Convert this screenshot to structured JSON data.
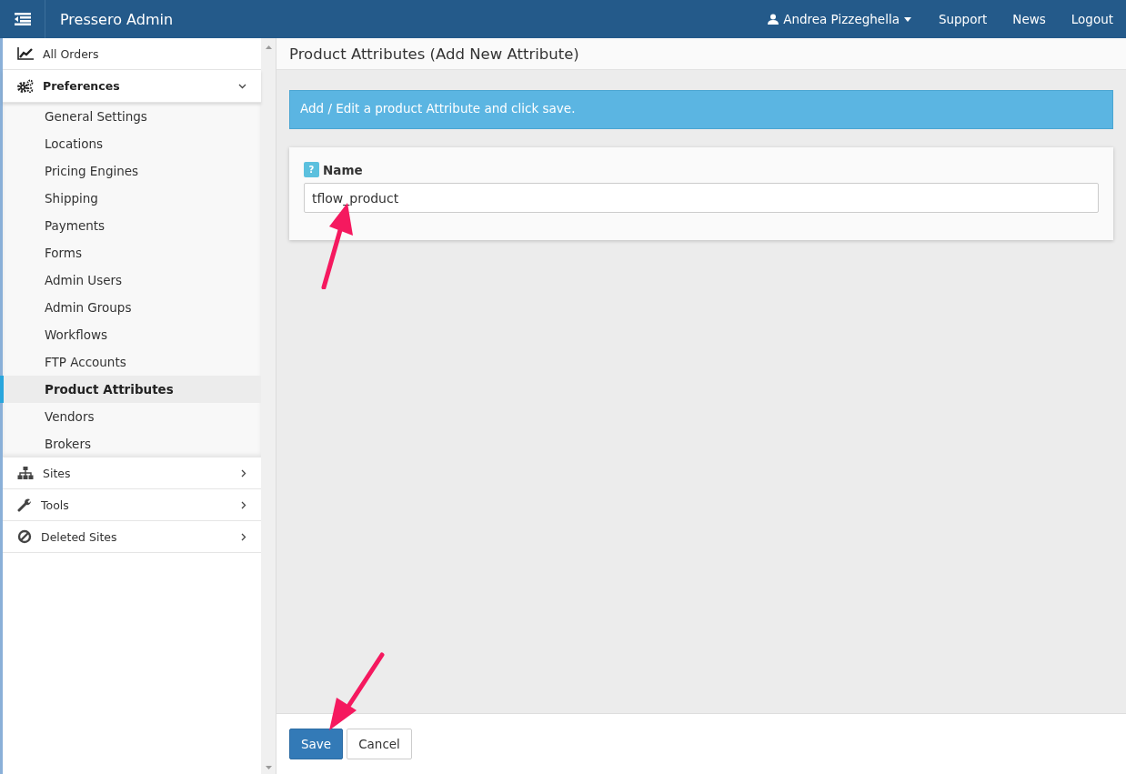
{
  "header": {
    "title": "Pressero Admin",
    "user": "Andrea Pizzeghella",
    "links": [
      "Support",
      "News",
      "Logout"
    ]
  },
  "sidebar": {
    "items": [
      {
        "label": "All Orders"
      },
      {
        "label": "Preferences",
        "expanded": true,
        "children": [
          {
            "label": "General Settings",
            "selected": false
          },
          {
            "label": "Locations",
            "selected": false
          },
          {
            "label": "Pricing Engines",
            "selected": false
          },
          {
            "label": "Shipping",
            "selected": false
          },
          {
            "label": "Payments",
            "selected": false
          },
          {
            "label": "Forms",
            "selected": false
          },
          {
            "label": "Admin Users",
            "selected": false
          },
          {
            "label": "Admin Groups",
            "selected": false
          },
          {
            "label": "Workflows",
            "selected": false
          },
          {
            "label": "FTP Accounts",
            "selected": false
          },
          {
            "label": "Product Attributes",
            "selected": true
          },
          {
            "label": "Vendors",
            "selected": false
          },
          {
            "label": "Brokers",
            "selected": false
          }
        ]
      },
      {
        "label": "Sites",
        "expanded": false
      },
      {
        "label": "Tools",
        "expanded": false
      },
      {
        "label": "Deleted Sites",
        "expanded": false
      }
    ]
  },
  "page": {
    "title": "Product Attributes (Add New Attribute)",
    "info": "Add / Edit a product Attribute and click save.",
    "field": {
      "help": "?",
      "label": "Name",
      "value": "tflow_product"
    },
    "buttons": [
      {
        "label": "Save",
        "kind": "primary"
      },
      {
        "label": "Cancel",
        "kind": "default"
      }
    ]
  }
}
